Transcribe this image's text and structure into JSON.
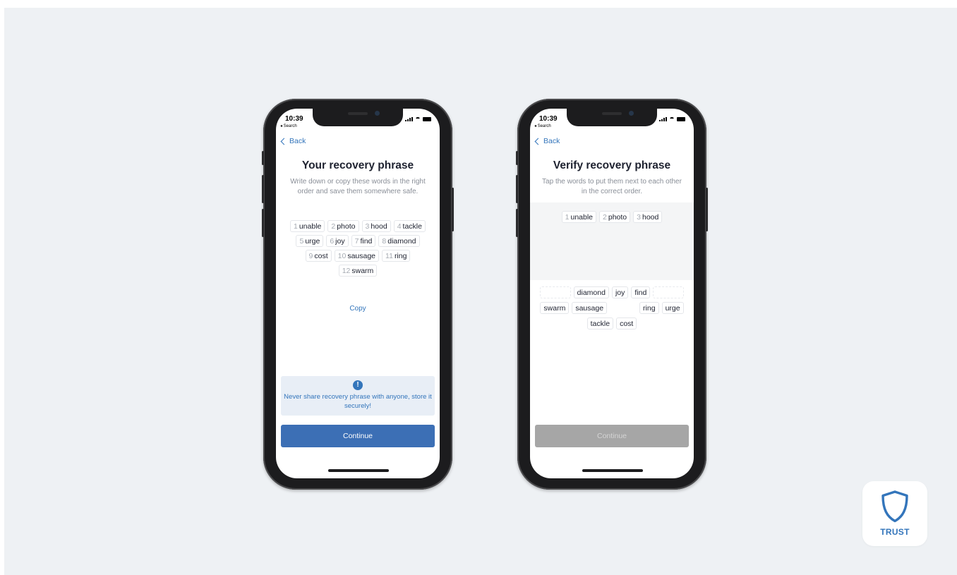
{
  "colors": {
    "accent": "#3375bb",
    "continue_active": "#3c6fb5",
    "continue_disabled": "#a6a6a6",
    "background": "#eef1f4",
    "warning_bg": "#e8eef6"
  },
  "status_bar": {
    "time": "10:39",
    "back_app": "◂ Search"
  },
  "left_screen": {
    "back_label": "Back",
    "title": "Your recovery phrase",
    "subtitle": "Write down or copy these words in the right order and save them somewhere safe.",
    "words": [
      {
        "num": "1",
        "word": "unable"
      },
      {
        "num": "2",
        "word": "photo"
      },
      {
        "num": "3",
        "word": "hood"
      },
      {
        "num": "4",
        "word": "tackle"
      },
      {
        "num": "5",
        "word": "urge"
      },
      {
        "num": "6",
        "word": "joy"
      },
      {
        "num": "7",
        "word": "find"
      },
      {
        "num": "8",
        "word": "diamond"
      },
      {
        "num": "9",
        "word": "cost"
      },
      {
        "num": "10",
        "word": "sausage"
      },
      {
        "num": "11",
        "word": "ring"
      },
      {
        "num": "12",
        "word": "swarm"
      }
    ],
    "copy_label": "Copy",
    "warning_icon": "exclamation-icon",
    "warning_text": "Never share recovery phrase with anyone, store it securely!",
    "continue_label": "Continue"
  },
  "right_screen": {
    "back_label": "Back",
    "title": "Verify recovery phrase",
    "subtitle": "Tap the words to put them next to each other in the correct order.",
    "selected_words": [
      {
        "num": "1",
        "word": "unable"
      },
      {
        "num": "2",
        "word": "photo"
      },
      {
        "num": "3",
        "word": "hood"
      }
    ],
    "pool_row1": [
      "",
      "diamond",
      "joy",
      "find",
      ""
    ],
    "pool_row2": [
      "swarm",
      "sausage",
      "",
      "ring",
      "urge"
    ],
    "pool_row3": [
      "tackle",
      "cost"
    ],
    "continue_label": "Continue"
  },
  "trust_badge": {
    "icon": "shield-icon",
    "label": "TRUST"
  }
}
